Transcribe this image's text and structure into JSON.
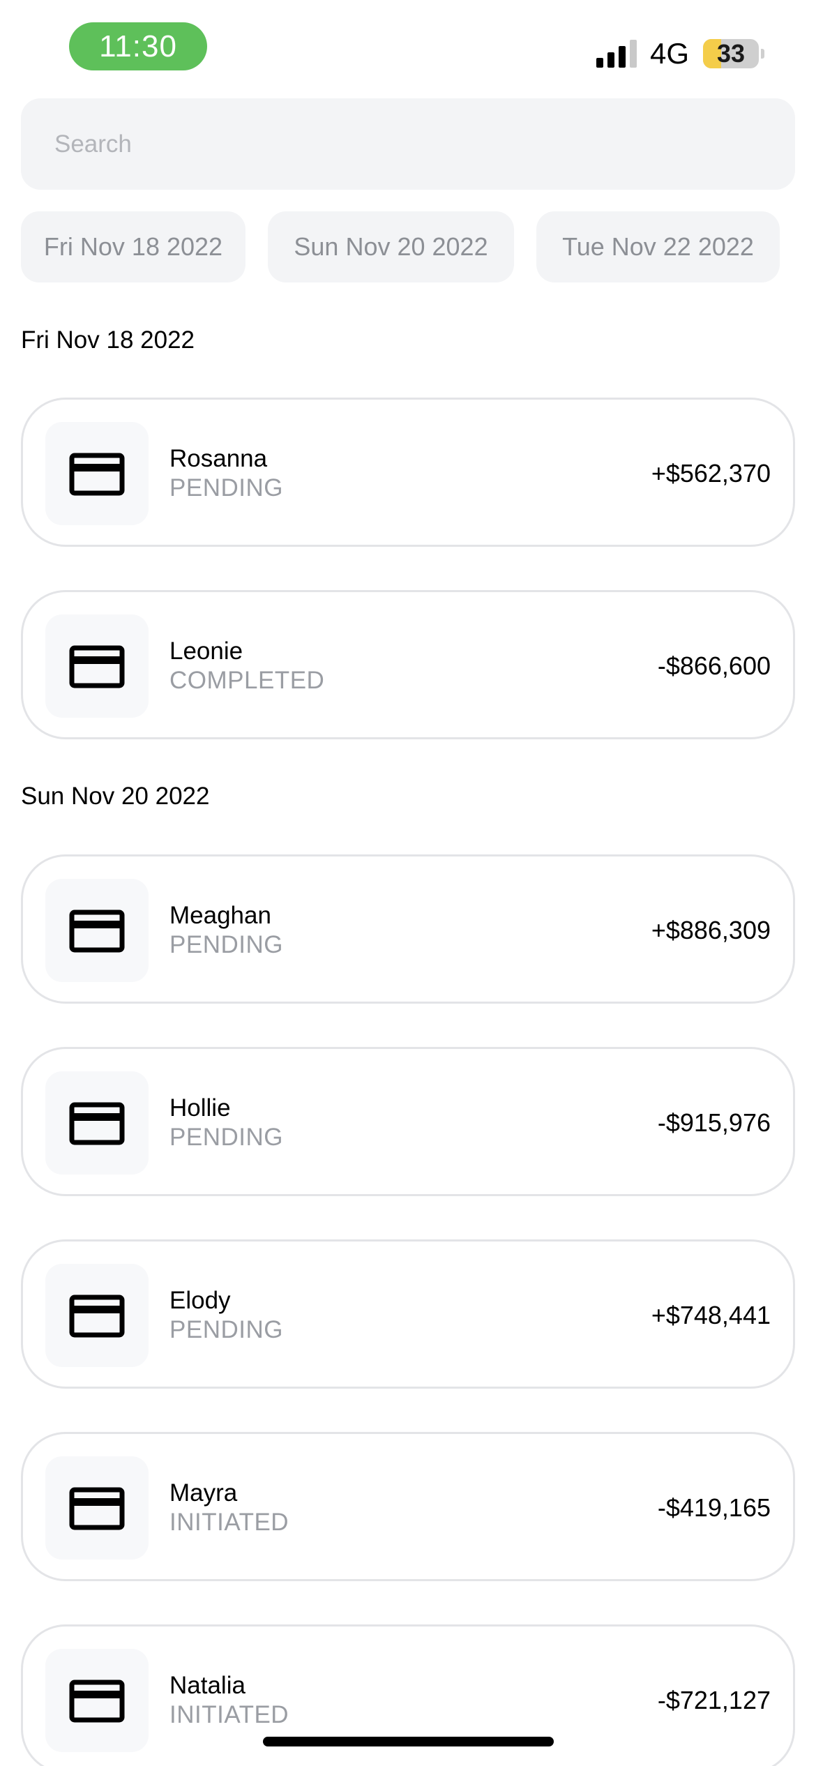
{
  "status_bar": {
    "time": "11:30",
    "network": "4G",
    "battery_level": "33",
    "battery_fraction": 0.33,
    "time_pill_color": "#5ec05a",
    "battery_color": "#f4cd4a"
  },
  "search": {
    "placeholder": "Search",
    "value": ""
  },
  "date_filters": [
    {
      "label": "Fri Nov 18 2022"
    },
    {
      "label": "Sun Nov 20 2022"
    },
    {
      "label": "Tue Nov 22 2022"
    }
  ],
  "sections": [
    {
      "heading": "Fri Nov 18 2022",
      "transactions": [
        {
          "name": "Rosanna",
          "status": "PENDING",
          "amount": "+$562,370",
          "icon": "credit-card-icon"
        },
        {
          "name": "Leonie",
          "status": "COMPLETED",
          "amount": "-$866,600",
          "icon": "credit-card-icon"
        }
      ]
    },
    {
      "heading": "Sun Nov 20 2022",
      "transactions": [
        {
          "name": "Meaghan",
          "status": "PENDING",
          "amount": "+$886,309",
          "icon": "credit-card-icon"
        },
        {
          "name": "Hollie",
          "status": "PENDING",
          "amount": "-$915,976",
          "icon": "credit-card-icon"
        },
        {
          "name": "Elody",
          "status": "PENDING",
          "amount": "+$748,441",
          "icon": "credit-card-icon"
        },
        {
          "name": "Mayra",
          "status": "INITIATED",
          "amount": "-$419,165",
          "icon": "credit-card-icon"
        },
        {
          "name": "Natalia",
          "status": "INITIATED",
          "amount": "-$721,127",
          "icon": "credit-card-icon"
        }
      ]
    }
  ]
}
